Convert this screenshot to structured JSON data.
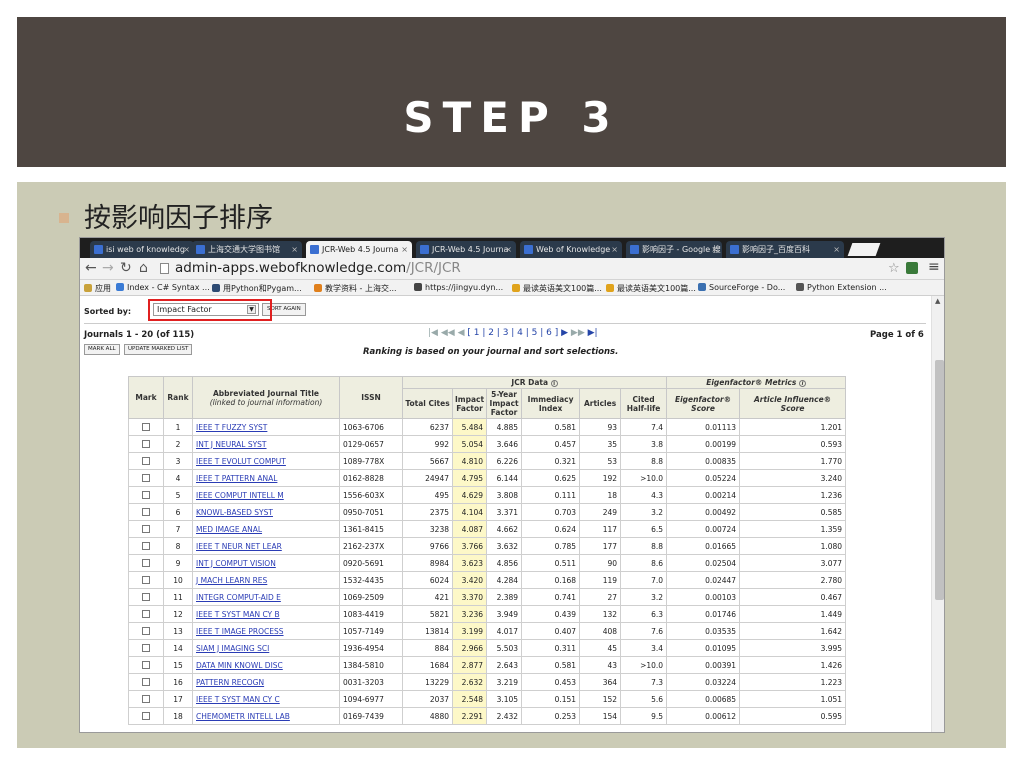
{
  "slide": {
    "title": "STEP 3",
    "bullet": "按影响因子排序",
    "colors": {
      "title_band": "#4e4641",
      "panel": "#cbcbb5",
      "bullet": "#d8b48f"
    }
  },
  "browser": {
    "tabs": [
      {
        "label": "isi web of knowledg",
        "active": false
      },
      {
        "label": "上海交通大学图书馆",
        "active": false
      },
      {
        "label": "JCR-Web 4.5 Journa",
        "active": true
      },
      {
        "label": "JCR-Web 4.5 Journa",
        "active": false
      },
      {
        "label": "Web of Knowledge",
        "active": false
      },
      {
        "label": "影响因子 - Google 搜",
        "active": false
      },
      {
        "label": "影响因子_百度百科",
        "active": false
      }
    ],
    "url_host": "admin-apps.webofknowledge.com",
    "url_path": "/JCR/JCR",
    "bookmarks": [
      {
        "label": "应用"
      },
      {
        "label": "Index - C# Syntax ..."
      },
      {
        "label": "用Python和Pygam..."
      },
      {
        "label": "教学资料 - 上海交..."
      },
      {
        "label": "https://jingyu.dyn..."
      },
      {
        "label": "最读英语美文100篇..."
      },
      {
        "label": "最读英语美文100篇..."
      },
      {
        "label": "SourceForge - Do..."
      },
      {
        "label": "Python Extension ..."
      }
    ]
  },
  "jcr": {
    "sorted_by_label": "Sorted by:",
    "sort_value": "Impact Factor",
    "sort_again": "SORT AGAIN",
    "journals_count": "Journals 1 - 20 (of 115)",
    "mark_all": "MARK ALL",
    "update_marked": "UPDATE MARKED LIST",
    "pager": "[ 1 | 2 | 3 | 4 | 5 | 6 ]",
    "ranking_note": "Ranking is based on your journal and sort selections.",
    "page_of": "Page 1 of 6",
    "headers": {
      "mark": "Mark",
      "rank": "Rank",
      "title": "Abbreviated Journal Title",
      "title_sub": "(linked to journal information)",
      "issn": "ISSN",
      "jcr_group": "JCR Data",
      "eigen_group": "Eigenfactor® Metrics",
      "total_cites": "Total Cites",
      "impact_factor": "Impact Factor",
      "five_year": "5-Year Impact Factor",
      "immediacy": "Immediacy Index",
      "articles": "Articles",
      "half_life": "Cited Half-life",
      "eigen_score": "Eigenfactor® Score",
      "article_influence": "Article Influence® Score"
    },
    "rows": [
      {
        "rank": "1",
        "title": "IEEE T FUZZY SYST",
        "issn": "1063-6706",
        "cites": "6237",
        "if": "5.484",
        "if5": "4.885",
        "imm": "0.581",
        "art": "93",
        "hl": "7.4",
        "eig": "0.01113",
        "ai": "1.201"
      },
      {
        "rank": "2",
        "title": "INT J NEURAL SYST",
        "issn": "0129-0657",
        "cites": "992",
        "if": "5.054",
        "if5": "3.646",
        "imm": "0.457",
        "art": "35",
        "hl": "3.8",
        "eig": "0.00199",
        "ai": "0.593"
      },
      {
        "rank": "3",
        "title": "IEEE T EVOLUT COMPUT",
        "issn": "1089-778X",
        "cites": "5667",
        "if": "4.810",
        "if5": "6.226",
        "imm": "0.321",
        "art": "53",
        "hl": "8.8",
        "eig": "0.00835",
        "ai": "1.770"
      },
      {
        "rank": "4",
        "title": "IEEE T PATTERN ANAL",
        "issn": "0162-8828",
        "cites": "24947",
        "if": "4.795",
        "if5": "6.144",
        "imm": "0.625",
        "art": "192",
        "hl": ">10.0",
        "eig": "0.05224",
        "ai": "3.240"
      },
      {
        "rank": "5",
        "title": "IEEE COMPUT INTELL M",
        "issn": "1556-603X",
        "cites": "495",
        "if": "4.629",
        "if5": "3.808",
        "imm": "0.111",
        "art": "18",
        "hl": "4.3",
        "eig": "0.00214",
        "ai": "1.236"
      },
      {
        "rank": "6",
        "title": "KNOWL-BASED SYST",
        "issn": "0950-7051",
        "cites": "2375",
        "if": "4.104",
        "if5": "3.371",
        "imm": "0.703",
        "art": "249",
        "hl": "3.2",
        "eig": "0.00492",
        "ai": "0.585"
      },
      {
        "rank": "7",
        "title": "MED IMAGE ANAL",
        "issn": "1361-8415",
        "cites": "3238",
        "if": "4.087",
        "if5": "4.662",
        "imm": "0.624",
        "art": "117",
        "hl": "6.5",
        "eig": "0.00724",
        "ai": "1.359"
      },
      {
        "rank": "8",
        "title": "IEEE T NEUR NET LEAR",
        "issn": "2162-237X",
        "cites": "9766",
        "if": "3.766",
        "if5": "3.632",
        "imm": "0.785",
        "art": "177",
        "hl": "8.8",
        "eig": "0.01665",
        "ai": "1.080"
      },
      {
        "rank": "9",
        "title": "INT J COMPUT VISION",
        "issn": "0920-5691",
        "cites": "8984",
        "if": "3.623",
        "if5": "4.856",
        "imm": "0.511",
        "art": "90",
        "hl": "8.6",
        "eig": "0.02504",
        "ai": "3.077"
      },
      {
        "rank": "10",
        "title": "J MACH LEARN RES",
        "issn": "1532-4435",
        "cites": "6024",
        "if": "3.420",
        "if5": "4.284",
        "imm": "0.168",
        "art": "119",
        "hl": "7.0",
        "eig": "0.02447",
        "ai": "2.780"
      },
      {
        "rank": "11",
        "title": "INTEGR COMPUT-AID E",
        "issn": "1069-2509",
        "cites": "421",
        "if": "3.370",
        "if5": "2.389",
        "imm": "0.741",
        "art": "27",
        "hl": "3.2",
        "eig": "0.00103",
        "ai": "0.467"
      },
      {
        "rank": "12",
        "title": "IEEE T SYST MAN CY B",
        "issn": "1083-4419",
        "cites": "5821",
        "if": "3.236",
        "if5": "3.949",
        "imm": "0.439",
        "art": "132",
        "hl": "6.3",
        "eig": "0.01746",
        "ai": "1.449"
      },
      {
        "rank": "13",
        "title": "IEEE T IMAGE PROCESS",
        "issn": "1057-7149",
        "cites": "13814",
        "if": "3.199",
        "if5": "4.017",
        "imm": "0.407",
        "art": "408",
        "hl": "7.6",
        "eig": "0.03535",
        "ai": "1.642"
      },
      {
        "rank": "14",
        "title": "SIAM J IMAGING SCI",
        "issn": "1936-4954",
        "cites": "884",
        "if": "2.966",
        "if5": "5.503",
        "imm": "0.311",
        "art": "45",
        "hl": "3.4",
        "eig": "0.01095",
        "ai": "3.995"
      },
      {
        "rank": "15",
        "title": "DATA MIN KNOWL DISC",
        "issn": "1384-5810",
        "cites": "1684",
        "if": "2.877",
        "if5": "2.643",
        "imm": "0.581",
        "art": "43",
        "hl": ">10.0",
        "eig": "0.00391",
        "ai": "1.426"
      },
      {
        "rank": "16",
        "title": "PATTERN RECOGN",
        "issn": "0031-3203",
        "cites": "13229",
        "if": "2.632",
        "if5": "3.219",
        "imm": "0.453",
        "art": "364",
        "hl": "7.3",
        "eig": "0.03224",
        "ai": "1.223"
      },
      {
        "rank": "17",
        "title": "IEEE T SYST MAN CY C",
        "issn": "1094-6977",
        "cites": "2037",
        "if": "2.548",
        "if5": "3.105",
        "imm": "0.151",
        "art": "152",
        "hl": "5.6",
        "eig": "0.00685",
        "ai": "1.051"
      },
      {
        "rank": "18",
        "title": "CHEMOMETR INTELL LAB",
        "issn": "0169-7439",
        "cites": "4880",
        "if": "2.291",
        "if5": "2.432",
        "imm": "0.253",
        "art": "154",
        "hl": "9.5",
        "eig": "0.00612",
        "ai": "0.595"
      }
    ]
  }
}
